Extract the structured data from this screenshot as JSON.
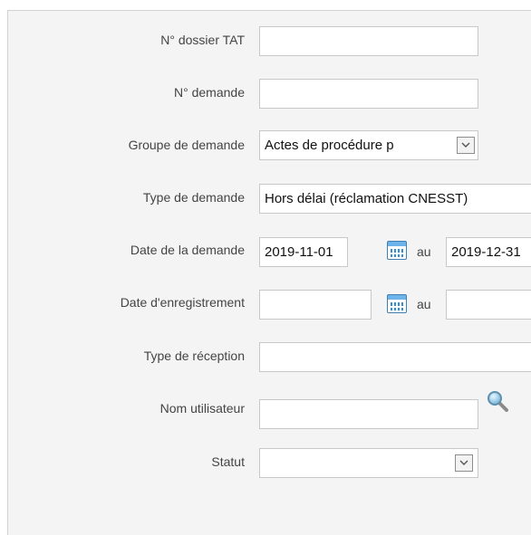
{
  "form": {
    "dossier": {
      "label": "N° dossier TAT",
      "value": ""
    },
    "demande": {
      "label": "N° demande",
      "value": ""
    },
    "groupe": {
      "label": "Groupe de demande",
      "value": "Actes de procédure p"
    },
    "type_demande": {
      "label": "Type de demande",
      "value": "Hors délai (réclamation CNESST)"
    },
    "date_demande": {
      "label": "Date de la demande",
      "from": "2019-11-01",
      "to_label": "au",
      "to": "2019-12-31"
    },
    "date_enreg": {
      "label": "Date d'enregistrement",
      "from": "",
      "to_label": "au",
      "to": ""
    },
    "type_reception": {
      "label": "Type de réception",
      "value": ""
    },
    "utilisateur": {
      "label": "Nom utilisateur",
      "value": ""
    },
    "statut": {
      "label": "Statut",
      "value": ""
    }
  },
  "icons": {
    "calendar": "calendar-icon",
    "search": "search-icon",
    "dropdown": "chevron-down-icon"
  },
  "colors": {
    "panel_bg": "#f4f4f4",
    "label_text": "#444444",
    "field_border": "#c8c8c8",
    "calendar_blue": "#2f8fd8"
  }
}
